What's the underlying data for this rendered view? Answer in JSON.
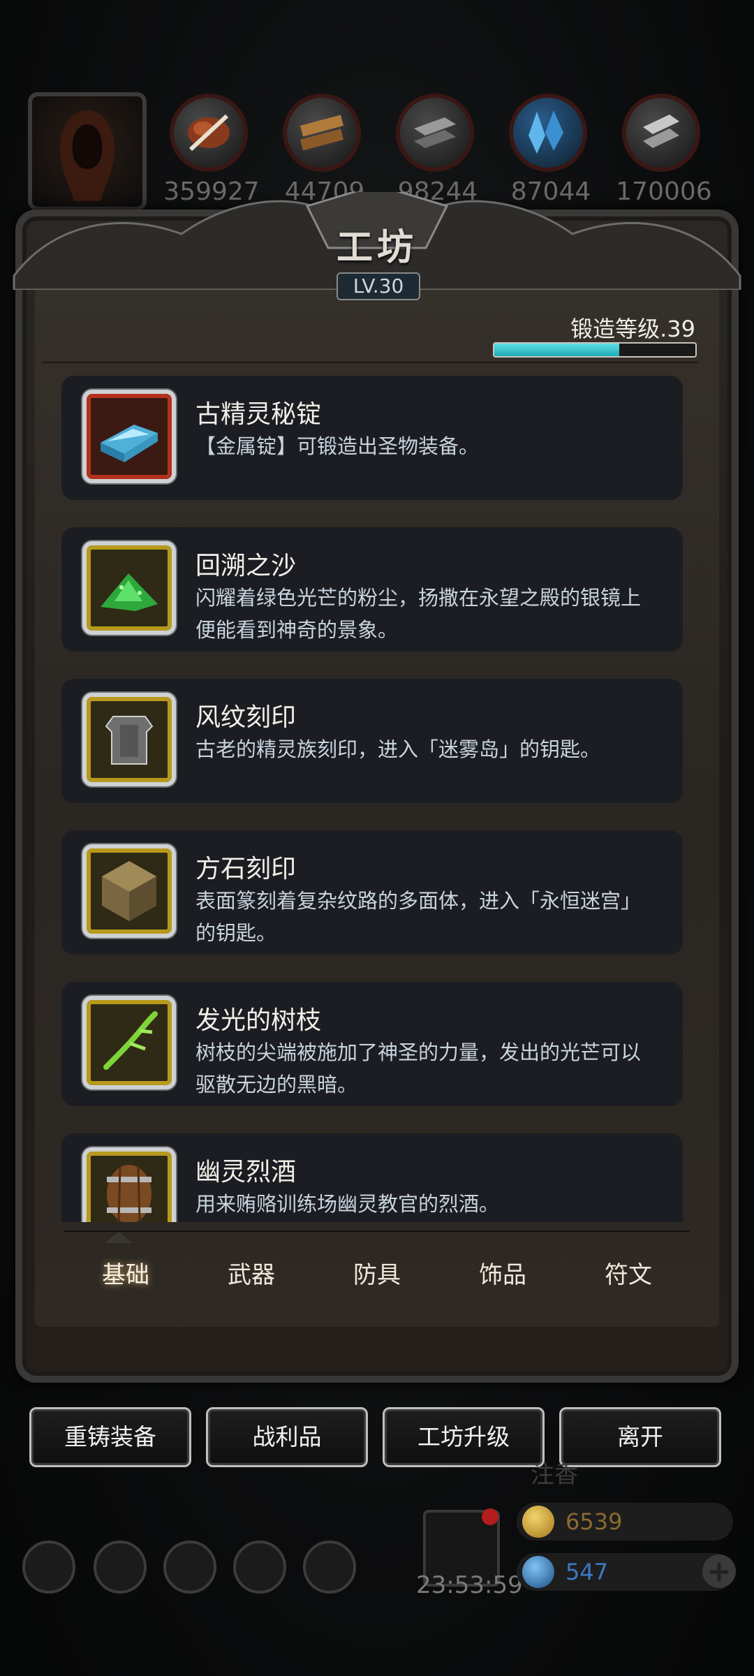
{
  "resources": [
    {
      "name": "meat-icon",
      "count": "359927"
    },
    {
      "name": "wood-icon",
      "count": "44709"
    },
    {
      "name": "iron-icon",
      "count": "98244"
    },
    {
      "name": "crystal-icon",
      "count": "87044"
    },
    {
      "name": "steel-icon",
      "count": "170006"
    }
  ],
  "workshop": {
    "title": "工坊",
    "level": "LV.30",
    "forge_level_label": "锻造等级.39",
    "forge_progress": 0.62
  },
  "items": [
    {
      "name": "古精灵秘锭",
      "desc": "【金属锭】可锻造出圣物装备。",
      "icon": "ingot-icon",
      "frame": "red"
    },
    {
      "name": "回溯之沙",
      "desc": "闪耀着绿色光芒的粉尘，扬撒在永望之殿的银镜上便能看到神奇的景象。",
      "icon": "green-sand-icon",
      "frame": "gold"
    },
    {
      "name": "风纹刻印",
      "desc": "古老的精灵族刻印，进入「迷雾岛」的钥匙。",
      "icon": "armor-seal-icon",
      "frame": "gold"
    },
    {
      "name": "方石刻印",
      "desc": "表面篆刻着复杂纹路的多面体，进入「永恒迷宫」的钥匙。",
      "icon": "stone-cube-icon",
      "frame": "gold"
    },
    {
      "name": "发光的树枝",
      "desc": "树枝的尖端被施加了神圣的力量，发出的光芒可以驱散无边的黑暗。",
      "icon": "glowing-branch-icon",
      "frame": "gold"
    },
    {
      "name": "幽灵烈酒",
      "desc": "用来贿赂训练场幽灵教官的烈酒。",
      "icon": "barrel-icon",
      "frame": "gold"
    }
  ],
  "tabs": [
    "基础",
    "武器",
    "防具",
    "饰品",
    "符文"
  ],
  "buttons": {
    "reforge": "重铸装备",
    "loot": "战利品",
    "upgrade": "工坊升级",
    "leave": "离开"
  },
  "hud": {
    "timer": "23:53:59",
    "gold": "6539",
    "gems": "547",
    "ghost_label": "注香"
  }
}
